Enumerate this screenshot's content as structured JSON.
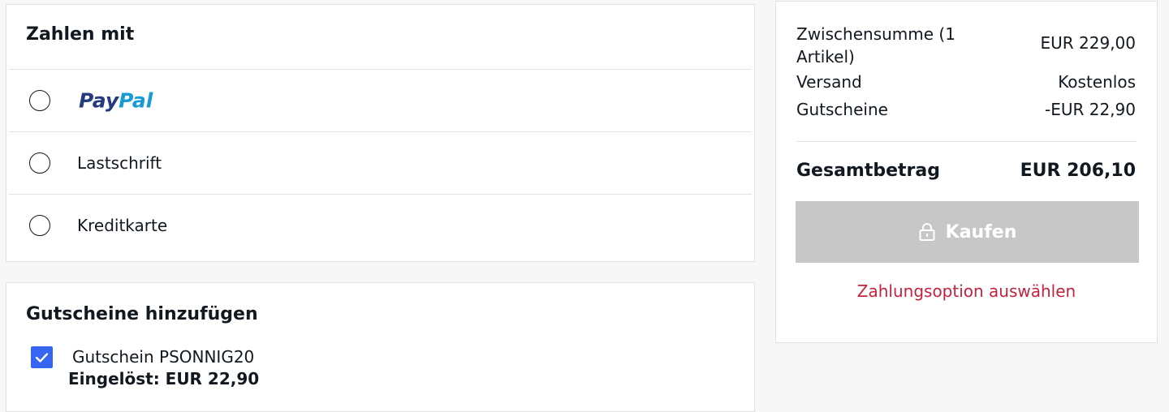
{
  "payment": {
    "title": "Zahlen mit",
    "options": [
      {
        "name": "PayPal",
        "logo_parts": [
          "Pay",
          "Pal"
        ],
        "selected": false
      },
      {
        "name": "Lastschrift",
        "selected": false
      },
      {
        "name": "Kreditkarte",
        "selected": false
      }
    ]
  },
  "coupons": {
    "title": "Gutscheine hinzufügen",
    "applied": {
      "checked": true,
      "label": "Gutschein PSONNIG20",
      "redeemed": "Eingelöst: EUR 22,90"
    }
  },
  "summary": {
    "subtotal_label_line1": "Zwischensumme (1",
    "subtotal_label_line2": "Artikel)",
    "subtotal_value": "EUR 229,00",
    "shipping_label": "Versand",
    "shipping_value": "Kostenlos",
    "coupons_label": "Gutscheine",
    "coupons_value": "-EUR 22,90",
    "total_label": "Gesamtbetrag",
    "total_value": "EUR 206,10",
    "buy_label": "Kaufen",
    "buy_icon": "lock-icon",
    "hint": "Zahlungsoption auswählen"
  },
  "colors": {
    "accent_blue": "#3665f3",
    "hint_red": "#c4233f",
    "disabled_button": "#c7c7c7",
    "paypal_dark": "#253b80",
    "paypal_light": "#179bd7"
  }
}
